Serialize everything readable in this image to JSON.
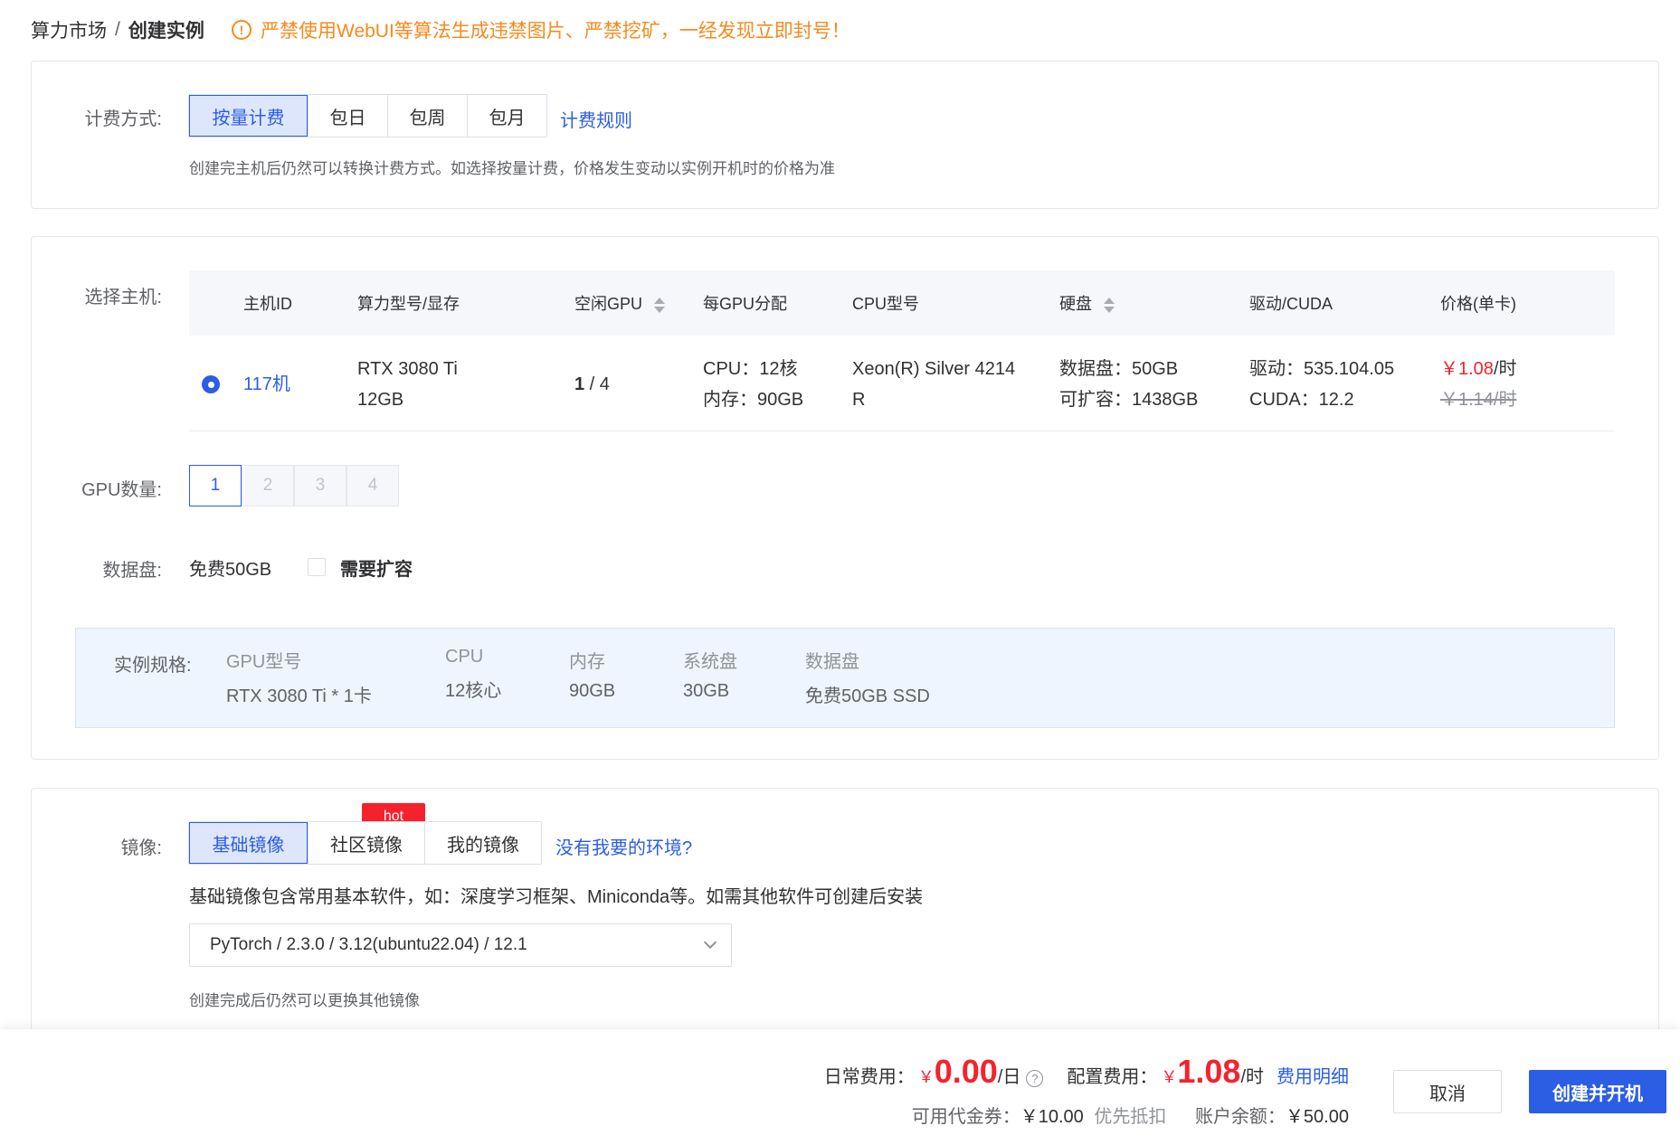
{
  "breadcrumb": {
    "parent": "算力市场",
    "separator": "/",
    "current": "创建实例"
  },
  "warning": {
    "icon": "exclamation-icon",
    "text": "严禁使用WebUI等算法生成违禁图片、严禁挖矿，一经发现立即封号！"
  },
  "billing": {
    "label": "计费方式:",
    "options": [
      "按量计费",
      "包日",
      "包周",
      "包月"
    ],
    "selected": "按量计费",
    "rules_link": "计费规则",
    "hint": "创建完主机后仍然可以转换计费方式。如选择按量计费，价格发生变动以实例开机时的价格为准"
  },
  "host": {
    "label": "选择主机:",
    "columns": [
      "主机ID",
      "算力型号/显存",
      "空闲GPU",
      "每GPU分配",
      "CPU型号",
      "硬盘",
      "驱动/CUDA",
      "价格(单卡)"
    ],
    "row": {
      "id": "117机",
      "model_line1": "RTX 3080 Ti",
      "model_line2": "12GB",
      "free_gpu_free": "1",
      "free_gpu_total": " / 4",
      "alloc_cpu": "CPU：12核",
      "alloc_mem": "内存：90GB",
      "cpu_line1": "Xeon(R) Silver 4214",
      "cpu_line2": "R",
      "disk_data": "数据盘：50GB",
      "disk_expand": "可扩容：1438GB",
      "driver": "驱动：535.104.05",
      "cuda": "CUDA：12.2",
      "price_current": "￥1.08",
      "price_unit": "/时",
      "price_original": "￥1.14/时",
      "selected": true
    }
  },
  "gpu_count": {
    "label": "GPU数量:",
    "options": [
      "1",
      "2",
      "3",
      "4"
    ],
    "selected": "1"
  },
  "data_disk": {
    "label": "数据盘:",
    "free": "免费50GB",
    "expand_label": "需要扩容",
    "expand_checked": false
  },
  "spec": {
    "label": "实例规格:",
    "items": [
      {
        "key": "GPU型号",
        "value": "RTX 3080 Ti * 1卡"
      },
      {
        "key": "CPU",
        "value": "12核心"
      },
      {
        "key": "内存",
        "value": "90GB"
      },
      {
        "key": "系统盘",
        "value": "30GB"
      },
      {
        "key": "数据盘",
        "value": "免费50GB SSD"
      }
    ]
  },
  "image": {
    "label": "镜像:",
    "tabs": [
      "基础镜像",
      "社区镜像",
      "我的镜像"
    ],
    "selected": "基础镜像",
    "hot_badge": "hot",
    "missing_link": "没有我要的环境?",
    "desc": "基础镜像包含常用基本软件，如：深度学习框架、Miniconda等。如需其他软件可创建后安装",
    "select_value": "PyTorch / 2.3.0 / 3.12(ubuntu22.04) / 12.1",
    "hint": "创建完成后仍然可以更换其他镜像"
  },
  "footer": {
    "daily_label": "日常费用：",
    "daily_currency": "￥",
    "daily_amount": "0.00",
    "daily_unit": "/日",
    "config_label": "配置费用：",
    "config_currency": "￥",
    "config_amount": "1.08",
    "config_unit": "/时",
    "detail_link": "费用明细",
    "voucher_label": "可用代金券：",
    "voucher_amount": "￥10.00",
    "voucher_note": "优先抵扣",
    "balance_label": "账户余额：",
    "balance_amount": "￥50.00",
    "cancel": "取消",
    "create": "创建并开机"
  },
  "colors": {
    "primary": "#2c5de5",
    "warning": "#f58a1f",
    "price": "#f5222d"
  }
}
